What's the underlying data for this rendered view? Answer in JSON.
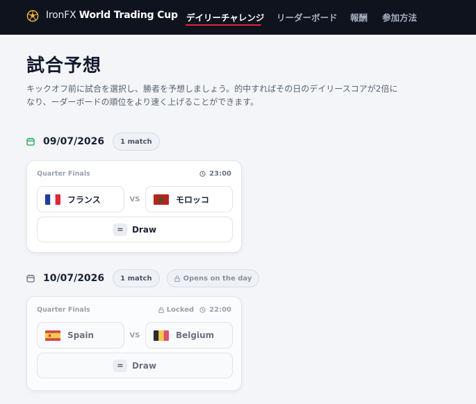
{
  "header": {
    "brand_plain": "IronFX",
    "brand_bold": "World Trading Cup",
    "nav": [
      "デイリーチャレンジ",
      "リーダーボード",
      "報酬",
      "参加方法"
    ]
  },
  "page": {
    "title": "試合予想",
    "description": "キックオフ前に試合を選択し、勝者を予想しましょう。的中すればその日のデイリースコアが2倍になり、ーダーボードの順位をより速く上げることができます。"
  },
  "days": [
    {
      "date": "09/07/2026",
      "count": "1 match",
      "status": "",
      "match": {
        "stage": "Quarter Finals",
        "locked": "",
        "time": "23:00",
        "home": "フランス",
        "away": "モロッコ",
        "vs": "VS",
        "draw_symbol": "=",
        "draw": "Draw"
      }
    },
    {
      "date": "10/07/2026",
      "count": "1 match",
      "status": "Opens on the day",
      "match": {
        "stage": "Quarter Finals",
        "locked": "Locked",
        "time": "22:00",
        "home": "Spain",
        "away": "Belgium",
        "vs": "VS",
        "draw_symbol": "=",
        "draw": "Draw"
      }
    }
  ],
  "colors": {
    "topbar": "#0e131e",
    "accent": "#e0263a",
    "calendar_active": "#16a34a",
    "calendar_inactive": "#6b7280"
  }
}
